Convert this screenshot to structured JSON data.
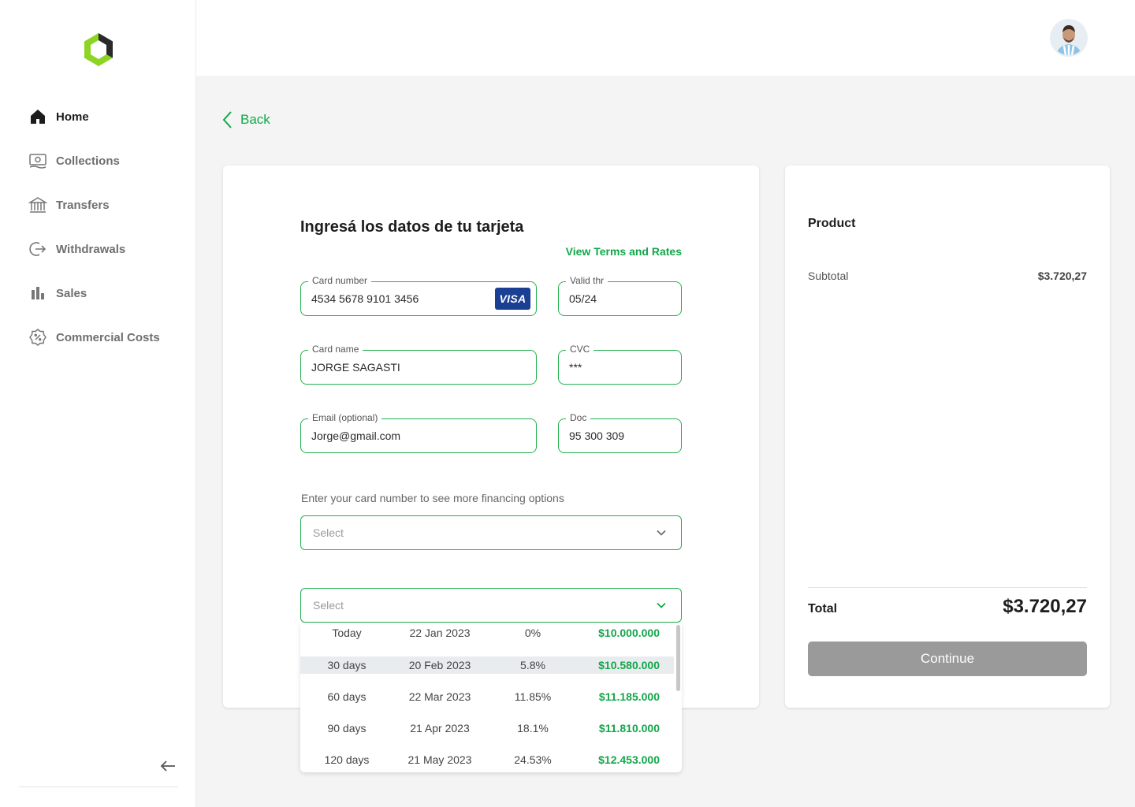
{
  "sidebar": {
    "items": [
      {
        "label": "Home",
        "icon": "home-icon",
        "active": true
      },
      {
        "label": "Collections",
        "icon": "banknote-icon"
      },
      {
        "label": "Transfers",
        "icon": "bank-icon"
      },
      {
        "label": "Withdrawals",
        "icon": "exit-arrow-icon"
      },
      {
        "label": "Sales",
        "icon": "bar-chart-icon"
      },
      {
        "label": "Commercial Costs",
        "icon": "percent-badge-icon"
      }
    ]
  },
  "back_label": "Back",
  "form": {
    "title": "Ingresá los datos de tu tarjeta",
    "terms_link": "View Terms and Rates",
    "card_number": {
      "label": "Card number",
      "value": "4534 5678 9101 3456",
      "brand": "VISA"
    },
    "valid_thru": {
      "label": "Valid thr",
      "value": "05/24"
    },
    "card_name": {
      "label": "Card name",
      "value": "JORGE SAGASTI"
    },
    "cvc": {
      "label": "CVC",
      "value": "***"
    },
    "email": {
      "label": "Email (optional)",
      "value": "Jorge@gmail.com"
    },
    "doc": {
      "label": "Doc",
      "value": "95 300 309"
    },
    "hint": "Enter your card number to see more financing options",
    "select1_placeholder": "Select",
    "select2_placeholder": "Select",
    "options": [
      {
        "term": "Today",
        "date": "22 Jan 2023",
        "rate": "0%",
        "amount": "$10.000.000"
      },
      {
        "term": "30 days",
        "date": "20 Feb 2023",
        "rate": "5.8%",
        "amount": "$10.580.000"
      },
      {
        "term": "60 days",
        "date": "22 Mar 2023",
        "rate": "11.85%",
        "amount": "$11.185.000"
      },
      {
        "term": "90 days",
        "date": "21 Apr 2023",
        "rate": "18.1%",
        "amount": "$11.810.000"
      },
      {
        "term": "120 days",
        "date": "21 May 2023",
        "rate": "24.53%",
        "amount": "$12.453.000"
      }
    ]
  },
  "summary": {
    "product_label": "Product",
    "subtotal_label": "Subtotal",
    "subtotal_value": "$3.720,27",
    "total_label": "Total",
    "total_value": "$3.720,27",
    "continue_label": "Continue"
  },
  "colors": {
    "accent": "#12a74a",
    "border": "#25b14f",
    "logo_green": "#8ed424",
    "button_disabled": "#9a9a9a"
  }
}
